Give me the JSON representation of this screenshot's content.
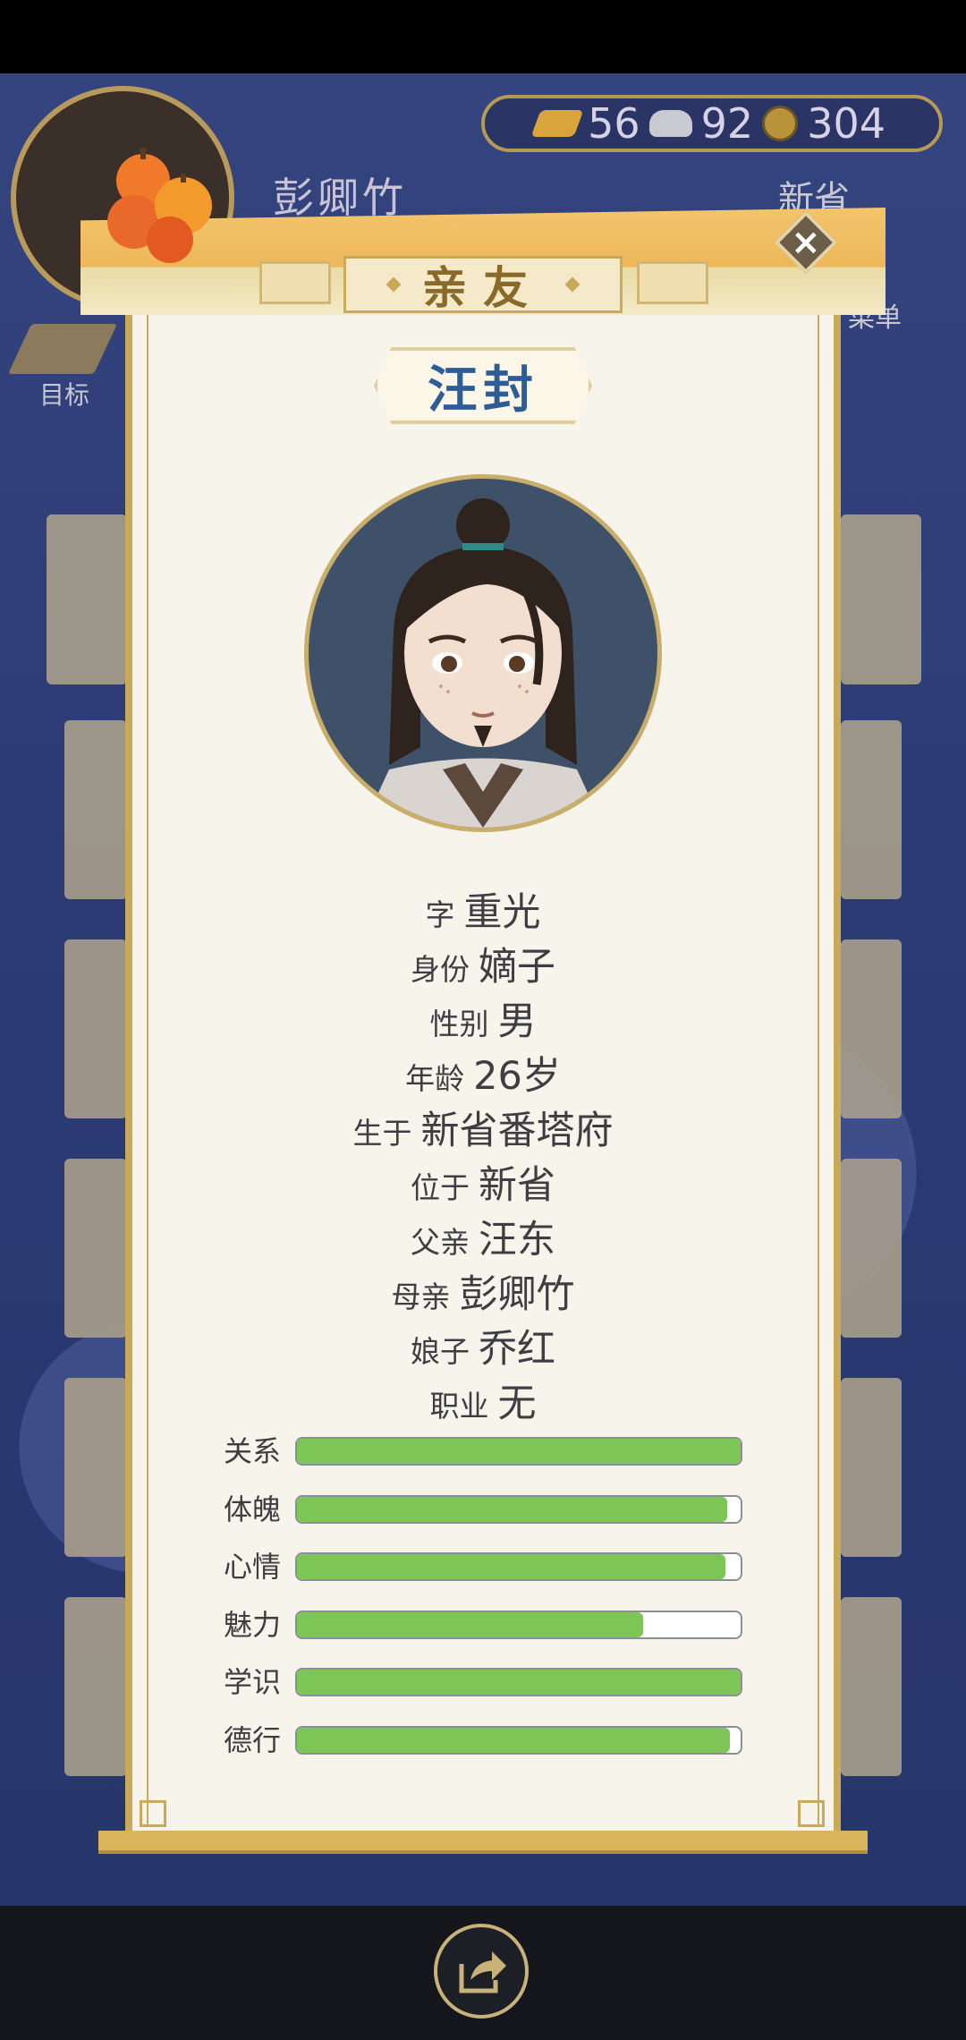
{
  "hud": {
    "player_name": "彭卿竹",
    "currency": {
      "gold": "56",
      "silver": "92",
      "copper": "304"
    },
    "region": "新省",
    "menu_label": "菜单",
    "goals_label": "目标"
  },
  "dialog": {
    "title": "亲友",
    "person_name": "汪封",
    "info": [
      {
        "label": "字",
        "value": "重光"
      },
      {
        "label": "身份",
        "value": "嫡子"
      },
      {
        "label": "性别",
        "value": "男"
      },
      {
        "label": "年龄",
        "value": "26岁"
      },
      {
        "label": "生于",
        "value": "新省番塔府"
      },
      {
        "label": "位于",
        "value": "新省"
      },
      {
        "label": "父亲",
        "value": "汪东"
      },
      {
        "label": "母亲",
        "value": "彭卿竹"
      },
      {
        "label": "娘子",
        "value": "乔红"
      },
      {
        "label": "职业",
        "value": "无"
      }
    ],
    "stats": [
      {
        "label": "关系",
        "level": 1.0
      },
      {
        "label": "体魄",
        "level": 0.97
      },
      {
        "label": "心情",
        "level": 0.965
      },
      {
        "label": "魅力",
        "level": 0.78
      },
      {
        "label": "学识",
        "level": 1.0
      },
      {
        "label": "德行",
        "level": 0.975
      }
    ]
  },
  "colors": {
    "accent_gold": "#c9a95a",
    "stat_fill": "#7dc556",
    "name_blue": "#2d5d96"
  },
  "icons": [
    "close-icon",
    "share-icon",
    "gold-ingot-icon",
    "silver-ingot-icon",
    "copper-coin-icon",
    "oranges-icon",
    "goals-icon"
  ]
}
